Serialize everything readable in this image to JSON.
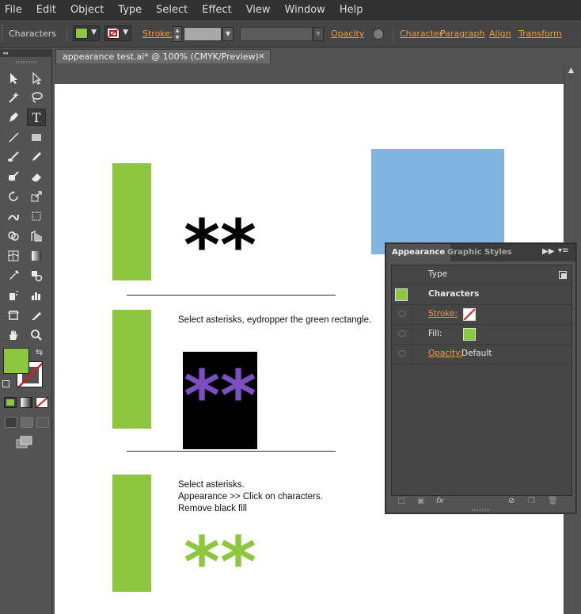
{
  "menubar": {
    "items": [
      "File",
      "Edit",
      "Object",
      "Type",
      "Select",
      "Effect",
      "View",
      "Window",
      "Help"
    ]
  },
  "controlbar": {
    "selection_label": "Characters",
    "stroke_label": "Stroke:",
    "opacity_label": "Opacity",
    "links": [
      "Character",
      "Paragraph",
      "Align",
      "Transform"
    ],
    "fill_color": "#8dc63f"
  },
  "document": {
    "tab_title": "appearance test.ai* @ 100% (CMYK/Preview)",
    "close_glyph": "×"
  },
  "artwork": {
    "asterisks_black": "**",
    "asterisks_purple": "**",
    "asterisks_green": "**",
    "instruction_1": "Select asterisks, eydropper the green rectangle.",
    "instruction_2_lines": [
      "Select asterisks.",
      "Appearance >> Click on characters.",
      "Remove black fill"
    ],
    "colors": {
      "green": "#8dc63f",
      "blue": "#82b4e1",
      "purple": "#7b4fc2",
      "black": "#000000"
    }
  },
  "appearance_panel": {
    "tabs": [
      "Appearance",
      "Graphic Styles"
    ],
    "header": "Type",
    "rows": [
      {
        "label": "Characters"
      },
      {
        "label": "Stroke:"
      },
      {
        "label": "Fill:"
      },
      {
        "label": "Opacity:",
        "value": "Default"
      }
    ],
    "footer_fx": "fx"
  },
  "toolbox": {
    "tools": [
      "selection-tool",
      "direct-selection-tool",
      "magic-wand-tool",
      "lasso-tool",
      "pen-tool",
      "type-tool",
      "line-tool",
      "rectangle-tool",
      "paintbrush-tool",
      "pencil-tool",
      "blob-brush-tool",
      "eraser-tool",
      "rotate-tool",
      "scale-tool",
      "warp-tool",
      "free-transform-tool",
      "shape-builder-tool",
      "perspective-grid-tool",
      "mesh-tool",
      "gradient-tool",
      "eyedropper-tool",
      "blend-tool",
      "symbol-sprayer-tool",
      "column-graph-tool",
      "artboard-tool",
      "slice-tool",
      "hand-tool",
      "zoom-tool"
    ],
    "fill_color": "#8dc63f"
  }
}
